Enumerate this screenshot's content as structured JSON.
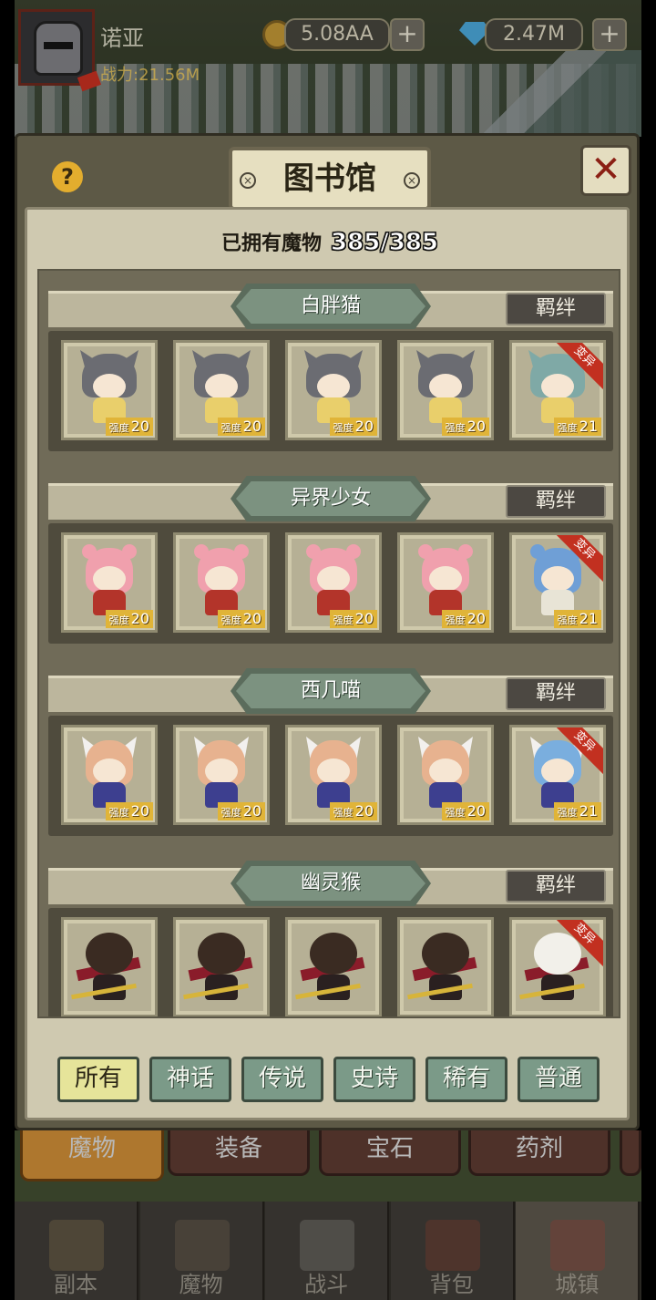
{
  "player": {
    "name": "诺亚",
    "power": "战力:21.56M"
  },
  "resources": {
    "gold": "5.08AA",
    "gems": "2.47M",
    "plus": "+"
  },
  "panel": {
    "title": "图书馆",
    "help": "?",
    "close": "✕",
    "screw": "×",
    "owned_label": "已拥有魔物",
    "owned_count": "385/385"
  },
  "bond_label": "羁绊",
  "level_label": "强度",
  "mutation_label": "变异",
  "groups": [
    {
      "name": "白胖猫",
      "levels": [
        "20",
        "20",
        "20",
        "20",
        "21"
      ]
    },
    {
      "name": "异界少女",
      "levels": [
        "20",
        "20",
        "20",
        "20",
        "21"
      ]
    },
    {
      "name": "西几喵",
      "levels": [
        "20",
        "20",
        "20",
        "20",
        "21"
      ]
    },
    {
      "name": "幽灵猴",
      "levels": []
    }
  ],
  "filters": [
    "所有",
    "神话",
    "传说",
    "史诗",
    "稀有",
    "普通"
  ],
  "filter_active": "所有",
  "category_tabs": [
    "魔物",
    "装备",
    "宝石",
    "药剂"
  ],
  "category_active": "魔物",
  "nav": [
    "副本",
    "魔物",
    "战斗",
    "背包",
    "城镇"
  ],
  "nav_active": "城镇",
  "colors": {
    "gold_badge": "#e0b438",
    "mutation": "#c23020",
    "panel": "#5d5946",
    "filter_active": "#e6e49a"
  }
}
